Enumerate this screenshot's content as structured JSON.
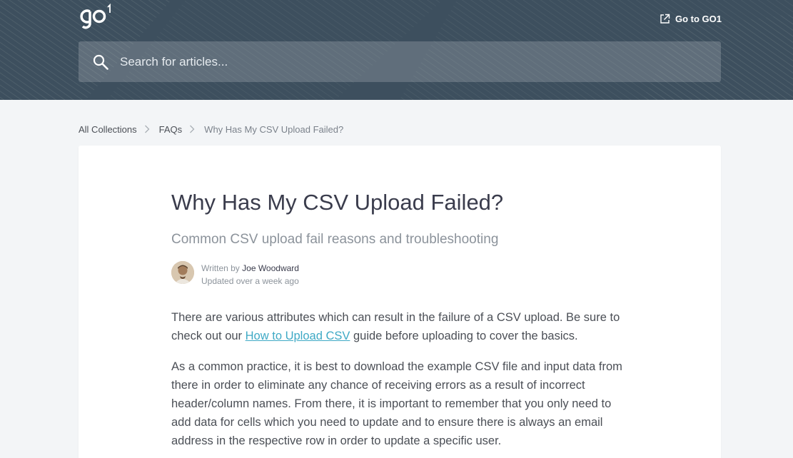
{
  "header": {
    "logo_label": "go1",
    "goto_label": "Go to GO1",
    "search_placeholder": "Search for articles...",
    "colors": {
      "background": "#3d4f5e",
      "pattern": "#5a6b79"
    }
  },
  "breadcrumb": {
    "items": [
      "All Collections",
      "FAQs"
    ],
    "current": "Why Has My CSV Upload Failed?"
  },
  "article": {
    "title": "Why Has My CSV Upload Failed?",
    "subtitle": "Common CSV upload fail reasons and troubleshooting",
    "written_by_prefix": "Written by",
    "author": "Joe Woodward",
    "updated": "Updated over a week ago",
    "p1_before": "There are various attributes which can result in the failure of a CSV upload. Be sure to check out our ",
    "p1_link": "How to Upload CSV",
    "p1_after": " guide before uploading to cover the basics.",
    "p2": "As a common practice, it is best to download the example CSV file and input data from there in order to eliminate any chance of receiving errors as a result of incorrect header/column names. From there, it is important to remember that you only need to add data for cells which you need to update and to ensure there is always an email address in the respective row in order to update a specific user."
  },
  "colors": {
    "link": "#3ea9c5",
    "title": "#3a3c4c",
    "muted": "#8c939b"
  }
}
